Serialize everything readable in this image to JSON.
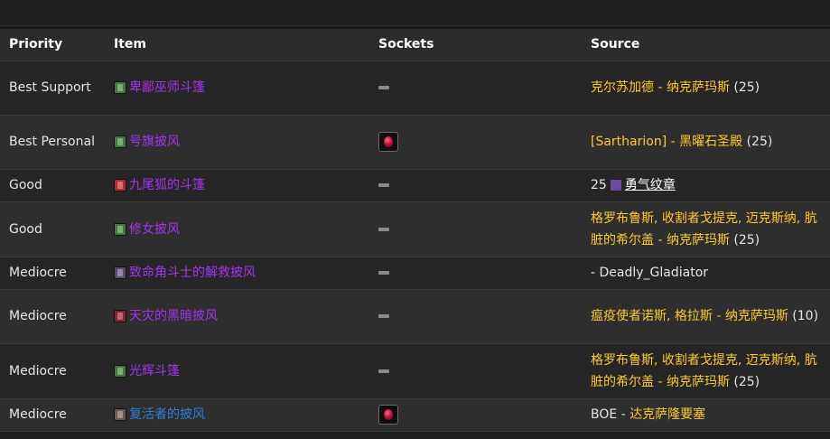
{
  "table": {
    "headers": {
      "priority": "Priority",
      "item": "Item",
      "sockets": "Sockets",
      "source": "Source"
    },
    "rows": [
      {
        "priority": "Best Support",
        "item": "卑鄙巫师斗篷",
        "item_quality": "epic",
        "icon_color": "#3f7a3a",
        "socket": "none",
        "source_parts": [
          {
            "text": "克尔苏加德 - 纳克萨玛斯",
            "type": "link"
          },
          {
            "text": " (25)",
            "type": "text"
          }
        ]
      },
      {
        "priority": "Best Personal",
        "item": "号旗披风",
        "item_quality": "epic",
        "icon_color": "#3f7a3a",
        "socket": "red",
        "source_parts": [
          {
            "text": "[Sartharion] - 黑曜石圣殿",
            "type": "link"
          },
          {
            "text": " (25)",
            "type": "text"
          }
        ]
      },
      {
        "priority": "Good",
        "item": "九尾狐的斗篷",
        "item_quality": "epic",
        "icon_color": "#b22a2a",
        "socket": "none",
        "source_parts": [
          {
            "text": "25",
            "type": "text"
          },
          {
            "text": "badge-icon",
            "type": "badge"
          },
          {
            "text": "勇气纹章",
            "type": "token"
          }
        ]
      },
      {
        "priority": "Good",
        "item": "修女披风",
        "item_quality": "epic",
        "icon_color": "#3f7a3a",
        "socket": "none",
        "source_parts": [
          {
            "text": "格罗布鲁斯, 收割者戈提克, 迈克斯纳, 肮脏的希尔盖 - 纳克萨玛斯",
            "type": "link"
          },
          {
            "text": " (25)",
            "type": "text"
          }
        ]
      },
      {
        "priority": "Mediocre",
        "item": "致命角斗士的解救披风",
        "item_quality": "epic",
        "icon_color": "#5a4a6e",
        "socket": "none",
        "source_parts": [
          {
            "text": "- Deadly_Gladiator",
            "type": "text"
          }
        ]
      },
      {
        "priority": "Mediocre",
        "item": "天灾的黑暗披风",
        "item_quality": "epic",
        "icon_color": "#8a2030",
        "socket": "none",
        "source_parts": [
          {
            "text": "瘟疫使者诺斯, 格拉斯 - 纳克萨玛斯",
            "type": "link"
          },
          {
            "text": " (10)",
            "type": "text"
          }
        ]
      },
      {
        "priority": "Mediocre",
        "item": "光辉斗篷",
        "item_quality": "epic",
        "icon_color": "#3f7a3a",
        "socket": "none",
        "source_parts": [
          {
            "text": "格罗布鲁斯, 收割者戈提克, 迈克斯纳, 肮脏的希尔盖 - 纳克萨玛斯",
            "type": "link"
          },
          {
            "text": " (25)",
            "type": "text"
          }
        ]
      },
      {
        "priority": "Mediocre",
        "item": "复活者的披风",
        "item_quality": "rare",
        "icon_color": "#6a5a4a",
        "socket": "red",
        "source_parts": [
          {
            "text": "BOE - ",
            "type": "text"
          },
          {
            "text": "达克萨隆要塞",
            "type": "link"
          }
        ]
      }
    ]
  }
}
